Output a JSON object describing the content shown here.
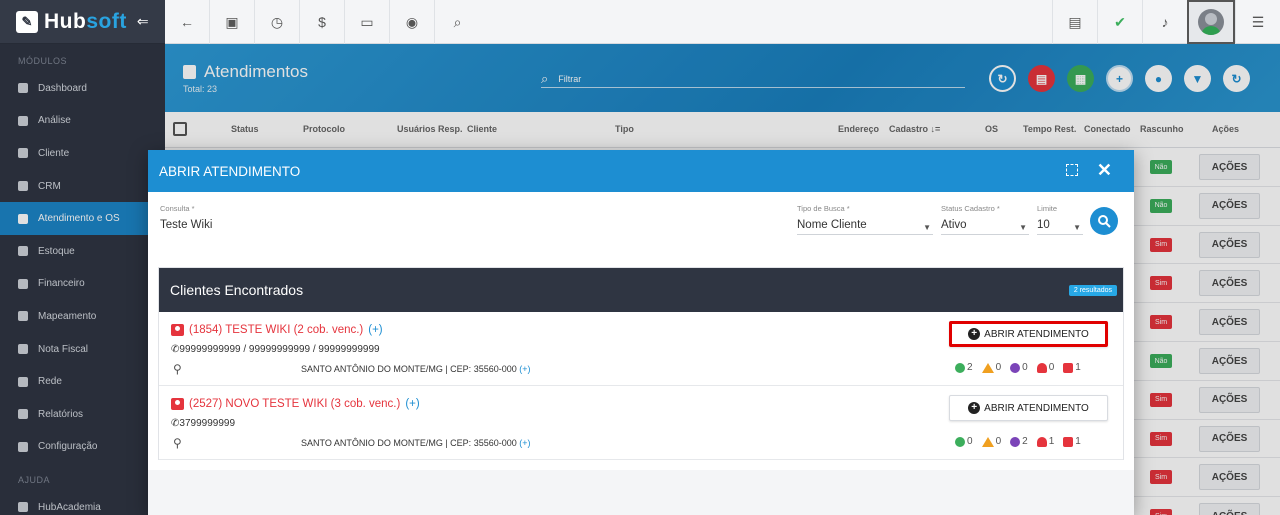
{
  "app": {
    "brand_hub": "Hub",
    "brand_soft": "soft",
    "collapse_glyph": "⇐"
  },
  "sidebar": {
    "section_modulos": "MÓDULOS",
    "section_ajuda": "AJUDA",
    "items": [
      {
        "label": "Dashboard",
        "icon": "dashboard-icon"
      },
      {
        "label": "Análise",
        "icon": "analytics-icon"
      },
      {
        "label": "Cliente",
        "icon": "client-icon"
      },
      {
        "label": "CRM",
        "icon": "crm-icon"
      },
      {
        "label": "Atendimento e OS",
        "icon": "support-icon",
        "active": true
      },
      {
        "label": "Estoque",
        "icon": "stock-icon"
      },
      {
        "label": "Financeiro",
        "icon": "finance-icon"
      },
      {
        "label": "Mapeamento",
        "icon": "map-pin-icon"
      },
      {
        "label": "Nota Fiscal",
        "icon": "invoice-icon"
      },
      {
        "label": "Rede",
        "icon": "network-icon"
      },
      {
        "label": "Relatórios",
        "icon": "reports-icon"
      },
      {
        "label": "Configuração",
        "icon": "gear-icon"
      }
    ],
    "help_items": [
      {
        "label": "HubAcademia",
        "icon": "academy-icon"
      }
    ]
  },
  "topbar": {
    "left_icons": [
      "back-arrow-icon",
      "contact-card-icon",
      "calendar-clock-icon",
      "dollar-icon",
      "terminal-icon",
      "eye-icon",
      "search-icon"
    ],
    "right_icons": [
      "pdf-icon",
      "chat-check-icon",
      "bell-icon",
      "user-avatar",
      "list-icon"
    ]
  },
  "header": {
    "title": "Atendimentos",
    "total": "Total: 23",
    "filter_placeholder": "Filtrar",
    "actions": [
      {
        "icon": "refresh-icon",
        "color": "#1d8ed2"
      },
      {
        "icon": "pdf-icon",
        "color": "#e5343d"
      },
      {
        "icon": "excel-icon",
        "color": "#3cae5c"
      },
      {
        "icon": "plus-icon",
        "color": "#ffffff"
      },
      {
        "icon": "user-icon",
        "color": "#ffffff"
      },
      {
        "icon": "filter-icon",
        "color": "#ffffff"
      },
      {
        "icon": "reload-icon",
        "color": "#ffffff"
      }
    ]
  },
  "table": {
    "columns": [
      "Status",
      "Protocolo",
      "Usuários Resp.",
      "Cliente",
      "Tipo",
      "Endereço",
      "Cadastro ↓=",
      "OS",
      "Tempo Rest.",
      "Conectado",
      "Rascunho",
      "Ações"
    ],
    "rascunho": [
      "Não",
      "Não",
      "Sim",
      "Sim",
      "Sim",
      "Não",
      "Sim",
      "Sim",
      "Sim",
      "Sim"
    ],
    "acoes_label": "AÇÕES"
  },
  "modal": {
    "title": "ABRIR ATENDIMENTO",
    "form": {
      "consulta_label": "Consulta *",
      "consulta_value": "Teste Wiki",
      "tipo_label": "Tipo de Busca *",
      "tipo_value": "Nome Cliente",
      "status_label": "Status Cadastro *",
      "status_value": "Ativo",
      "limite_label": "Limite",
      "limite_value": "10"
    },
    "results_title": "Clientes Encontrados",
    "results_badge": "2 resultados",
    "open_label": "ABRIR ATENDIMENTO",
    "results": [
      {
        "name": "(1854) TESTE WIKI (2 cob. venc.)",
        "plus": "(+)",
        "phone": "99999999999 / 99999999999 / 99999999999",
        "address": "SANTO ANTÔNIO DO MONTE/MG | CEP: 35560-000",
        "addr_plus": "(+)",
        "stats": [
          "2",
          "0",
          "0",
          "0",
          "1"
        ],
        "highlight": true
      },
      {
        "name": "(2527) NOVO TESTE WIKI (3 cob. venc.)",
        "plus": "(+)",
        "phone": "3799999999",
        "address": "SANTO ANTÔNIO DO MONTE/MG | CEP: 35560-000",
        "addr_plus": "(+)",
        "stats": [
          "0",
          "0",
          "2",
          "1",
          "1"
        ],
        "highlight": false
      }
    ]
  }
}
